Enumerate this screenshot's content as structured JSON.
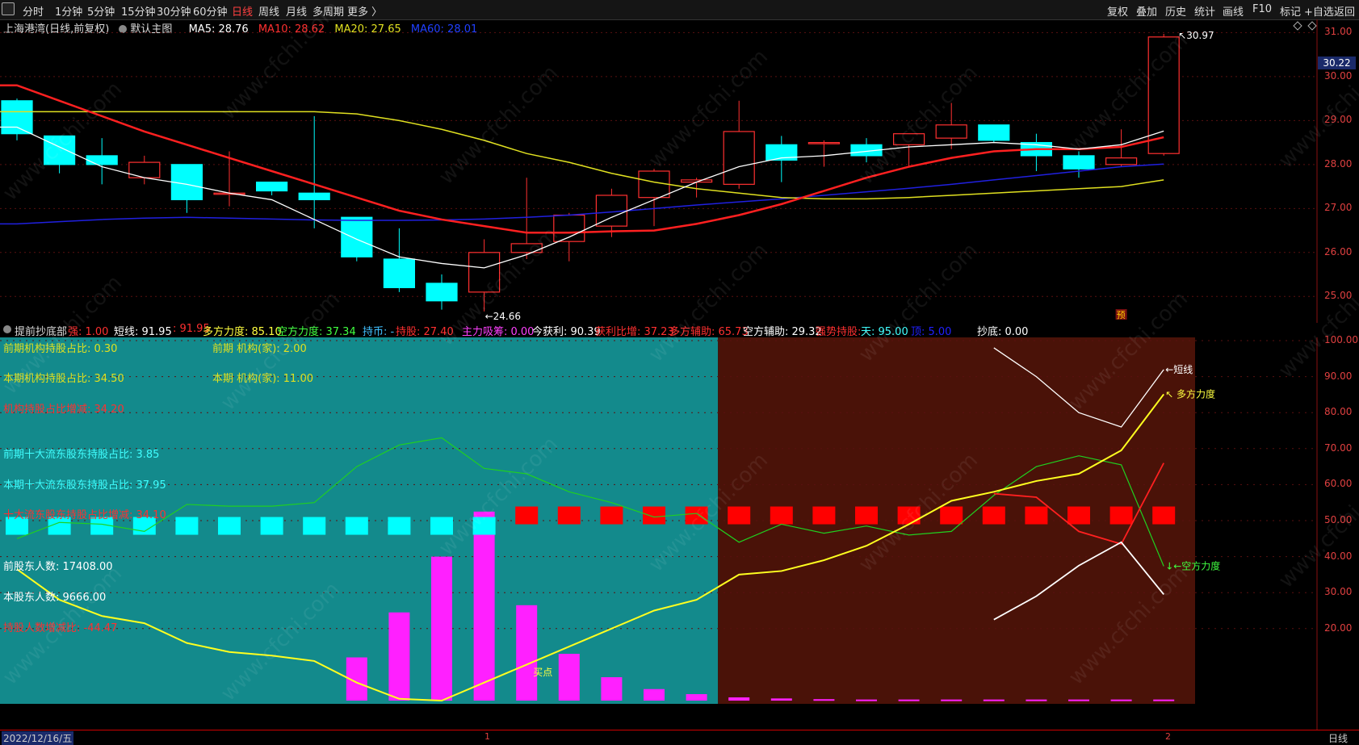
{
  "toolbar": {
    "periods": [
      "分时",
      "1分钟",
      "5分钟",
      "15分钟",
      "30分钟",
      "60分钟",
      "日线",
      "周线",
      "月线",
      "多周期",
      "更多 〉"
    ],
    "active_period": "日线",
    "right_buttons": [
      "复权",
      "叠加",
      "历史",
      "统计",
      "画线",
      "F10",
      "标记",
      "+自选",
      "返回"
    ]
  },
  "main_header": {
    "stock": "上海港湾(日线,前复权)",
    "template": "默认主图",
    "ma5": "MA5: 28.76",
    "ma10": "MA10: 28.62",
    "ma20": "MA20: 27.65",
    "ma60": "MA60: 28.01"
  },
  "price_axis": [
    "31.00",
    "30.00",
    "29.00",
    "28.00",
    "27.00",
    "26.00",
    "25.00"
  ],
  "current_price": "30.22",
  "annotations": {
    "high": "30.97",
    "low": "24.66",
    "pre": "预",
    "buy": "买点",
    "short_line": "短线",
    "long_power": "多方力度",
    "short_power": "空方力度"
  },
  "sub_header": {
    "name": "提前抄底部",
    "items": [
      {
        "text": "强: 1.00",
        "color": "#ff3030"
      },
      {
        "text": "短线: 91.95",
        "color": "#ffffff"
      },
      {
        "text": ": 91.95",
        "color": "#ff3030"
      },
      {
        "text": "多方力度: 85.10",
        "color": "#ffff40"
      },
      {
        "text": "空方力度: 37.34",
        "color": "#40ff40"
      },
      {
        "text": "持币: -",
        "color": "#40c0ff"
      },
      {
        "text": "持股: 27.40",
        "color": "#ff3030"
      },
      {
        "text": "主力吸筹: 0.00",
        "color": "#ff40ff"
      },
      {
        "text": "今获利: 90.39",
        "color": "#ffffff"
      },
      {
        "text": "获利比增: 37.23",
        "color": "#ff3030"
      },
      {
        "text": "多方辅助: 65.73",
        "color": "#ff3030"
      },
      {
        "text": "空方辅助: 29.32",
        "color": "#ffffff"
      },
      {
        "text": "强势持股: -",
        "color": "#ff3030"
      },
      {
        "text": "天: 95.00",
        "color": "#40ffff"
      },
      {
        "text": "顶: 5.00",
        "color": "#2020ff"
      },
      {
        "text": "抄底: 0.00",
        "color": "#ffffff"
      }
    ]
  },
  "info": {
    "l1": "前期机构持股占比: 0.30",
    "r1": "前期 机构(家): 2.00",
    "l2": "本期机构持股占比: 34.50",
    "r2": "本期 机构(家): 11.00",
    "l3": "机构持股占比增减: 34.20",
    "l4": "前期十大流东股东持股占比: 3.85",
    "l5": "本期十大流东股东持股占比: 37.95",
    "l6": "十大流东股东持股占比增减: 34.10",
    "l7": "前股东人数: 17408.00",
    "l8": "本股东人数: 9666.00",
    "l9": "持股人数增减比: -44.47"
  },
  "ind_axis": [
    "100.00",
    "90.00",
    "80.00",
    "70.00",
    "60.00",
    "50.00",
    "40.00",
    "30.00",
    "20.00"
  ],
  "bottom": {
    "date": "2022/12/16/五",
    "period": "日线",
    "marker1": "1",
    "marker2": "2"
  },
  "watermark": "www.cfchi.com",
  "colors": {
    "up": "#ff3030",
    "down": "#00ffff",
    "ma5": "#ffffff",
    "ma10": "#ff2020",
    "ma20": "#e0e020",
    "ma60": "#2020e0",
    "teal_zone": "#138a8c",
    "brown_zone": "#4a1208",
    "magenta": "#ff20ff"
  },
  "chart_data": {
    "type": "candlestick",
    "candles": [
      {
        "o": 29.45,
        "h": 29.5,
        "l": 28.55,
        "c": 28.7
      },
      {
        "o": 28.65,
        "h": 28.65,
        "l": 27.8,
        "c": 28.0
      },
      {
        "o": 28.2,
        "h": 28.6,
        "l": 27.55,
        "c": 28.0
      },
      {
        "o": 27.7,
        "h": 28.2,
        "l": 27.55,
        "c": 28.05
      },
      {
        "o": 28.0,
        "h": 28.0,
        "l": 26.9,
        "c": 27.2
      },
      {
        "o": 27.35,
        "h": 28.3,
        "l": 27.05,
        "c": 27.35
      },
      {
        "o": 27.6,
        "h": 27.6,
        "l": 27.3,
        "c": 27.4
      },
      {
        "o": 27.35,
        "h": 29.1,
        "l": 26.55,
        "c": 27.2
      },
      {
        "o": 26.8,
        "h": 26.8,
        "l": 25.8,
        "c": 25.9
      },
      {
        "o": 25.85,
        "h": 26.55,
        "l": 25.1,
        "c": 25.2
      },
      {
        "o": 25.3,
        "h": 25.5,
        "l": 24.7,
        "c": 24.9
      },
      {
        "o": 25.1,
        "h": 26.3,
        "l": 24.66,
        "c": 26.0
      },
      {
        "o": 26.0,
        "h": 27.7,
        "l": 25.85,
        "c": 26.2
      },
      {
        "o": 26.25,
        "h": 26.9,
        "l": 25.8,
        "c": 26.85
      },
      {
        "o": 26.6,
        "h": 27.45,
        "l": 26.35,
        "c": 27.3
      },
      {
        "o": 27.25,
        "h": 27.9,
        "l": 26.6,
        "c": 27.85
      },
      {
        "o": 27.6,
        "h": 27.7,
        "l": 27.25,
        "c": 27.65
      },
      {
        "o": 27.55,
        "h": 29.45,
        "l": 27.45,
        "c": 28.75
      },
      {
        "o": 28.45,
        "h": 28.65,
        "l": 27.6,
        "c": 28.1
      },
      {
        "o": 28.5,
        "h": 28.55,
        "l": 27.95,
        "c": 28.5
      },
      {
        "o": 28.45,
        "h": 28.6,
        "l": 28.05,
        "c": 28.2
      },
      {
        "o": 28.45,
        "h": 28.7,
        "l": 27.95,
        "c": 28.7
      },
      {
        "o": 28.6,
        "h": 29.4,
        "l": 28.35,
        "c": 28.9
      },
      {
        "o": 28.9,
        "h": 28.9,
        "l": 28.5,
        "c": 28.55
      },
      {
        "o": 28.5,
        "h": 28.7,
        "l": 27.85,
        "c": 28.2
      },
      {
        "o": 28.2,
        "h": 28.3,
        "l": 27.7,
        "c": 27.9
      },
      {
        "o": 28.0,
        "h": 28.8,
        "l": 27.95,
        "c": 28.15
      },
      {
        "o": 28.25,
        "h": 30.97,
        "l": 28.2,
        "c": 30.9
      }
    ],
    "ma5": [
      28.85,
      28.4,
      27.95,
      27.7,
      27.55,
      27.35,
      27.2,
      26.75,
      26.3,
      25.9,
      25.75,
      25.65,
      25.95,
      26.35,
      26.8,
      27.2,
      27.6,
      27.95,
      28.15,
      28.2,
      28.3,
      28.4,
      28.45,
      28.5,
      28.45,
      28.35,
      28.45,
      28.76
    ],
    "ma10": [
      29.8,
      29.45,
      29.1,
      28.75,
      28.45,
      28.15,
      27.85,
      27.55,
      27.25,
      26.95,
      26.75,
      26.6,
      26.45,
      26.45,
      26.48,
      26.5,
      26.65,
      26.85,
      27.1,
      27.4,
      27.7,
      27.95,
      28.15,
      28.3,
      28.35,
      28.35,
      28.4,
      28.62
    ],
    "ma20": [
      29.2,
      29.2,
      29.2,
      29.2,
      29.2,
      29.2,
      29.2,
      29.2,
      29.15,
      29.0,
      28.8,
      28.55,
      28.25,
      28.05,
      27.8,
      27.6,
      27.45,
      27.35,
      27.25,
      27.22,
      27.22,
      27.25,
      27.3,
      27.35,
      27.4,
      27.45,
      27.5,
      27.65
    ],
    "ma60": [
      26.65,
      26.7,
      26.75,
      26.78,
      26.8,
      26.78,
      26.76,
      26.74,
      26.73,
      26.73,
      26.74,
      26.76,
      26.8,
      26.85,
      26.92,
      27.0,
      27.08,
      27.15,
      27.22,
      27.3,
      27.38,
      27.46,
      27.55,
      27.65,
      27.75,
      27.85,
      27.95,
      28.01
    ],
    "price_range": [
      24.4,
      31.3
    ],
    "indicator": {
      "range": [
        0,
        100
      ],
      "yellow": [
        36.5,
        28,
        23.5,
        21.5,
        16,
        13.5,
        12.5,
        11,
        5,
        0.5,
        0,
        5,
        10,
        15,
        20,
        25,
        28,
        35,
        36,
        39,
        43,
        49,
        55.5,
        58,
        61,
        63,
        69.5,
        85.1
      ],
      "green": [
        45,
        49.5,
        49,
        47,
        54.5,
        54,
        54,
        55,
        65,
        71,
        73,
        64.5,
        63,
        58,
        55,
        51,
        52,
        44,
        49,
        46.5,
        48.5,
        46,
        47,
        57,
        65,
        68,
        65.5,
        37.34
      ],
      "red_seg": [
        null,
        null,
        null,
        null,
        null,
        null,
        null,
        null,
        null,
        null,
        null,
        null,
        null,
        null,
        null,
        null,
        null,
        null,
        null,
        null,
        null,
        null,
        null,
        57.5,
        56.5,
        47,
        43.5,
        66
      ],
      "white_top": [
        null,
        null,
        null,
        null,
        null,
        null,
        null,
        null,
        null,
        null,
        null,
        null,
        null,
        null,
        null,
        null,
        null,
        null,
        null,
        null,
        null,
        null,
        null,
        98,
        90,
        80,
        76,
        91.95
      ],
      "white_bot": [
        null,
        null,
        null,
        null,
        null,
        null,
        null,
        null,
        null,
        null,
        null,
        null,
        null,
        null,
        null,
        null,
        null,
        null,
        null,
        null,
        null,
        null,
        null,
        22.5,
        29,
        37.5,
        44,
        29.5
      ],
      "magenta_bars": [
        0,
        0,
        0,
        0,
        0,
        0,
        0,
        0,
        12,
        24.5,
        40,
        52.5,
        26.5,
        13,
        6.5,
        3.2,
        1.8,
        0.9,
        0.6,
        0.4,
        0.3,
        0.3,
        0.3,
        0.3,
        0.3,
        0.3,
        0.3,
        0.3
      ],
      "cyan_blocks_until": 11,
      "red_blocks_from": 12,
      "block_level": 51,
      "brown_from": 17
    }
  }
}
